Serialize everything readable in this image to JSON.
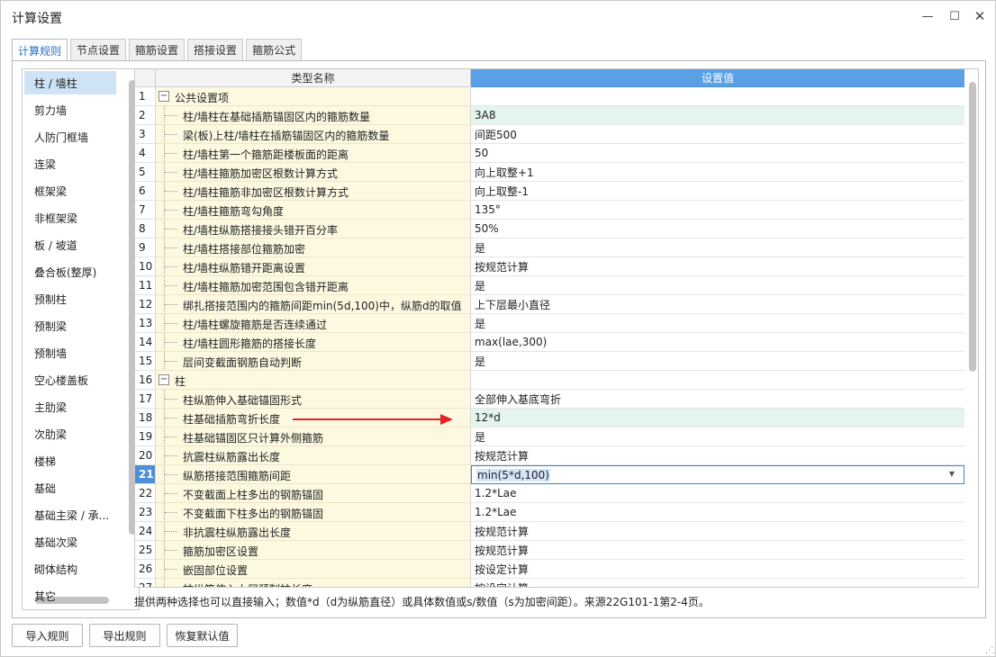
{
  "window": {
    "title": "计算设置",
    "minimize_glyph": "—",
    "maximize_glyph": "☐",
    "close_glyph": "✕"
  },
  "tabs": [
    {
      "label": "计算规则",
      "active": true
    },
    {
      "label": "节点设置",
      "active": false
    },
    {
      "label": "箍筋设置",
      "active": false
    },
    {
      "label": "搭接设置",
      "active": false
    },
    {
      "label": "箍筋公式",
      "active": false
    }
  ],
  "sidebar": {
    "items": [
      {
        "label": "柱 / 墙柱",
        "selected": true
      },
      {
        "label": "剪力墙"
      },
      {
        "label": "人防门框墙"
      },
      {
        "label": "连梁"
      },
      {
        "label": "框架梁"
      },
      {
        "label": "非框架梁"
      },
      {
        "label": "板 / 坡道"
      },
      {
        "label": "叠合板(整厚)"
      },
      {
        "label": "预制柱"
      },
      {
        "label": "预制梁"
      },
      {
        "label": "预制墙"
      },
      {
        "label": "空心楼盖板"
      },
      {
        "label": "主肋梁"
      },
      {
        "label": "次肋梁"
      },
      {
        "label": "楼梯"
      },
      {
        "label": "基础"
      },
      {
        "label": "基础主梁 / 承..."
      },
      {
        "label": "基础次梁"
      },
      {
        "label": "砌体结构"
      },
      {
        "label": "其它"
      }
    ]
  },
  "grid": {
    "col_name": "类型名称",
    "col_value": "设置值",
    "current_row": 21,
    "expander_glyph": "−",
    "rows": [
      {
        "no": "1",
        "name": "公共设置项",
        "value": "",
        "group": true
      },
      {
        "no": "2",
        "name": "柱/墙柱在基础插筋锚固区内的箍筋数量",
        "value": "3A8",
        "highlight": true
      },
      {
        "no": "3",
        "name": "梁(板)上柱/墙柱在插筋锚固区内的箍筋数量",
        "value": "间距500"
      },
      {
        "no": "4",
        "name": "柱/墙柱第一个箍筋距楼板面的距离",
        "value": "50"
      },
      {
        "no": "5",
        "name": "柱/墙柱箍筋加密区根数计算方式",
        "value": "向上取整+1"
      },
      {
        "no": "6",
        "name": "柱/墙柱箍筋非加密区根数计算方式",
        "value": "向上取整-1"
      },
      {
        "no": "7",
        "name": "柱/墙柱箍筋弯勾角度",
        "value": "135°"
      },
      {
        "no": "8",
        "name": "柱/墙柱纵筋搭接接头错开百分率",
        "value": "50%"
      },
      {
        "no": "9",
        "name": "柱/墙柱搭接部位箍筋加密",
        "value": "是"
      },
      {
        "no": "10",
        "name": "柱/墙柱纵筋错开距离设置",
        "value": "按规范计算"
      },
      {
        "no": "11",
        "name": "柱/墙柱箍筋加密范围包含错开距离",
        "value": "是"
      },
      {
        "no": "12",
        "name": "绑扎搭接范围内的箍筋间距min(5d,100)中，纵筋d的取值",
        "value": "上下层最小直径"
      },
      {
        "no": "13",
        "name": "柱/墙柱螺旋箍筋是否连续通过",
        "value": "是"
      },
      {
        "no": "14",
        "name": "柱/墙柱圆形箍筋的搭接长度",
        "value": "max(lae,300)"
      },
      {
        "no": "15",
        "name": "层间变截面钢筋自动判断",
        "value": "是"
      },
      {
        "no": "16",
        "name": "柱",
        "value": "",
        "group": true
      },
      {
        "no": "17",
        "name": "柱纵筋伸入基础锚固形式",
        "value": "全部伸入基底弯折"
      },
      {
        "no": "18",
        "name": "柱基础插筋弯折长度",
        "value": "12*d",
        "highlight": true
      },
      {
        "no": "19",
        "name": "柱基础锚固区只计算外侧箍筋",
        "value": "是"
      },
      {
        "no": "20",
        "name": "抗震柱纵筋露出长度",
        "value": "按规范计算"
      },
      {
        "no": "21",
        "name": "纵筋搭接范围箍筋间距",
        "value": "min(5*d,100)",
        "editing": true
      },
      {
        "no": "22",
        "name": "不变截面上柱多出的钢筋锚固",
        "value": "1.2*Lae"
      },
      {
        "no": "23",
        "name": "不变截面下柱多出的钢筋锚固",
        "value": "1.2*Lae"
      },
      {
        "no": "24",
        "name": "非抗震柱纵筋露出长度",
        "value": "按规范计算"
      },
      {
        "no": "25",
        "name": "箍筋加密区设置",
        "value": "按规范计算"
      },
      {
        "no": "26",
        "name": "嵌固部位设置",
        "value": "按设定计算"
      },
      {
        "no": "27",
        "name": "柱纵筋伸入上层预制柱长度",
        "value": "按设定计算"
      }
    ]
  },
  "hint": "提供两种选择也可以直接输入；数值*d（d为纵筋直径）或具体数值或s/数值（s为加密间距）。来源22G101-1第2-4页。",
  "buttons": {
    "import": "导入规则",
    "export": "导出规则",
    "restore": "恢复默认值"
  },
  "colors": {
    "accent": "#1f6fd1",
    "header_value_bg": "#5aa0e6",
    "current_row_bg": "#4d8fd8",
    "name_cell_bg": "#fdf9e1",
    "highlight_value_bg": "#e3f5ec",
    "annotation_arrow": "#e52323"
  }
}
